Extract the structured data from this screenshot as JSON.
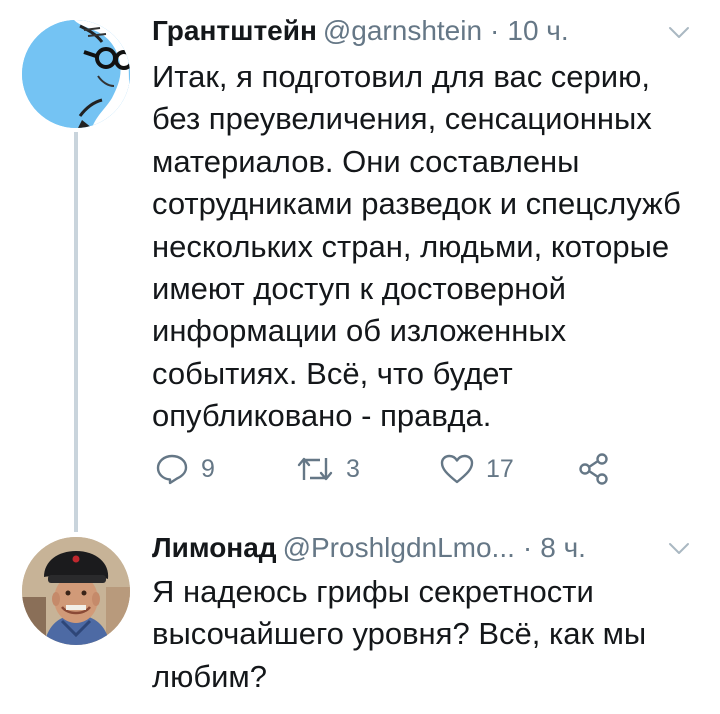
{
  "tweets": [
    {
      "name": "Грантштейн",
      "handle": "@garnshtein",
      "separator": "·",
      "time": "10 ч.",
      "text": "Итак, я подготовил для вас серию, без преувеличения,  сенсационных материалов. Они составлены сотрудниками разведок и спецслужб нескольких стран, людьми, которые имеют доступ к достоверной информации об изложенных событиях. Всё, что будет опубликовано - правда.",
      "actions": {
        "replies": "9",
        "retweets": "3",
        "likes": "17"
      }
    },
    {
      "name": "Лимонад",
      "handle": "@ProshlgdnLmo...",
      "separator": "·",
      "time": "8 ч.",
      "text": "Я надеюсь грифы секретности высочайшего уровня? Всё, как мы любим?"
    }
  ],
  "icons": {
    "reply": "reply-icon",
    "retweet": "retweet-icon",
    "like": "heart-icon",
    "share": "share-icon",
    "menu": "chevron-down-icon"
  },
  "colors": {
    "text": "#14171a",
    "secondary": "#657786",
    "thread_line": "#c9d4dc",
    "avatar_bg": "#74c3f3"
  }
}
